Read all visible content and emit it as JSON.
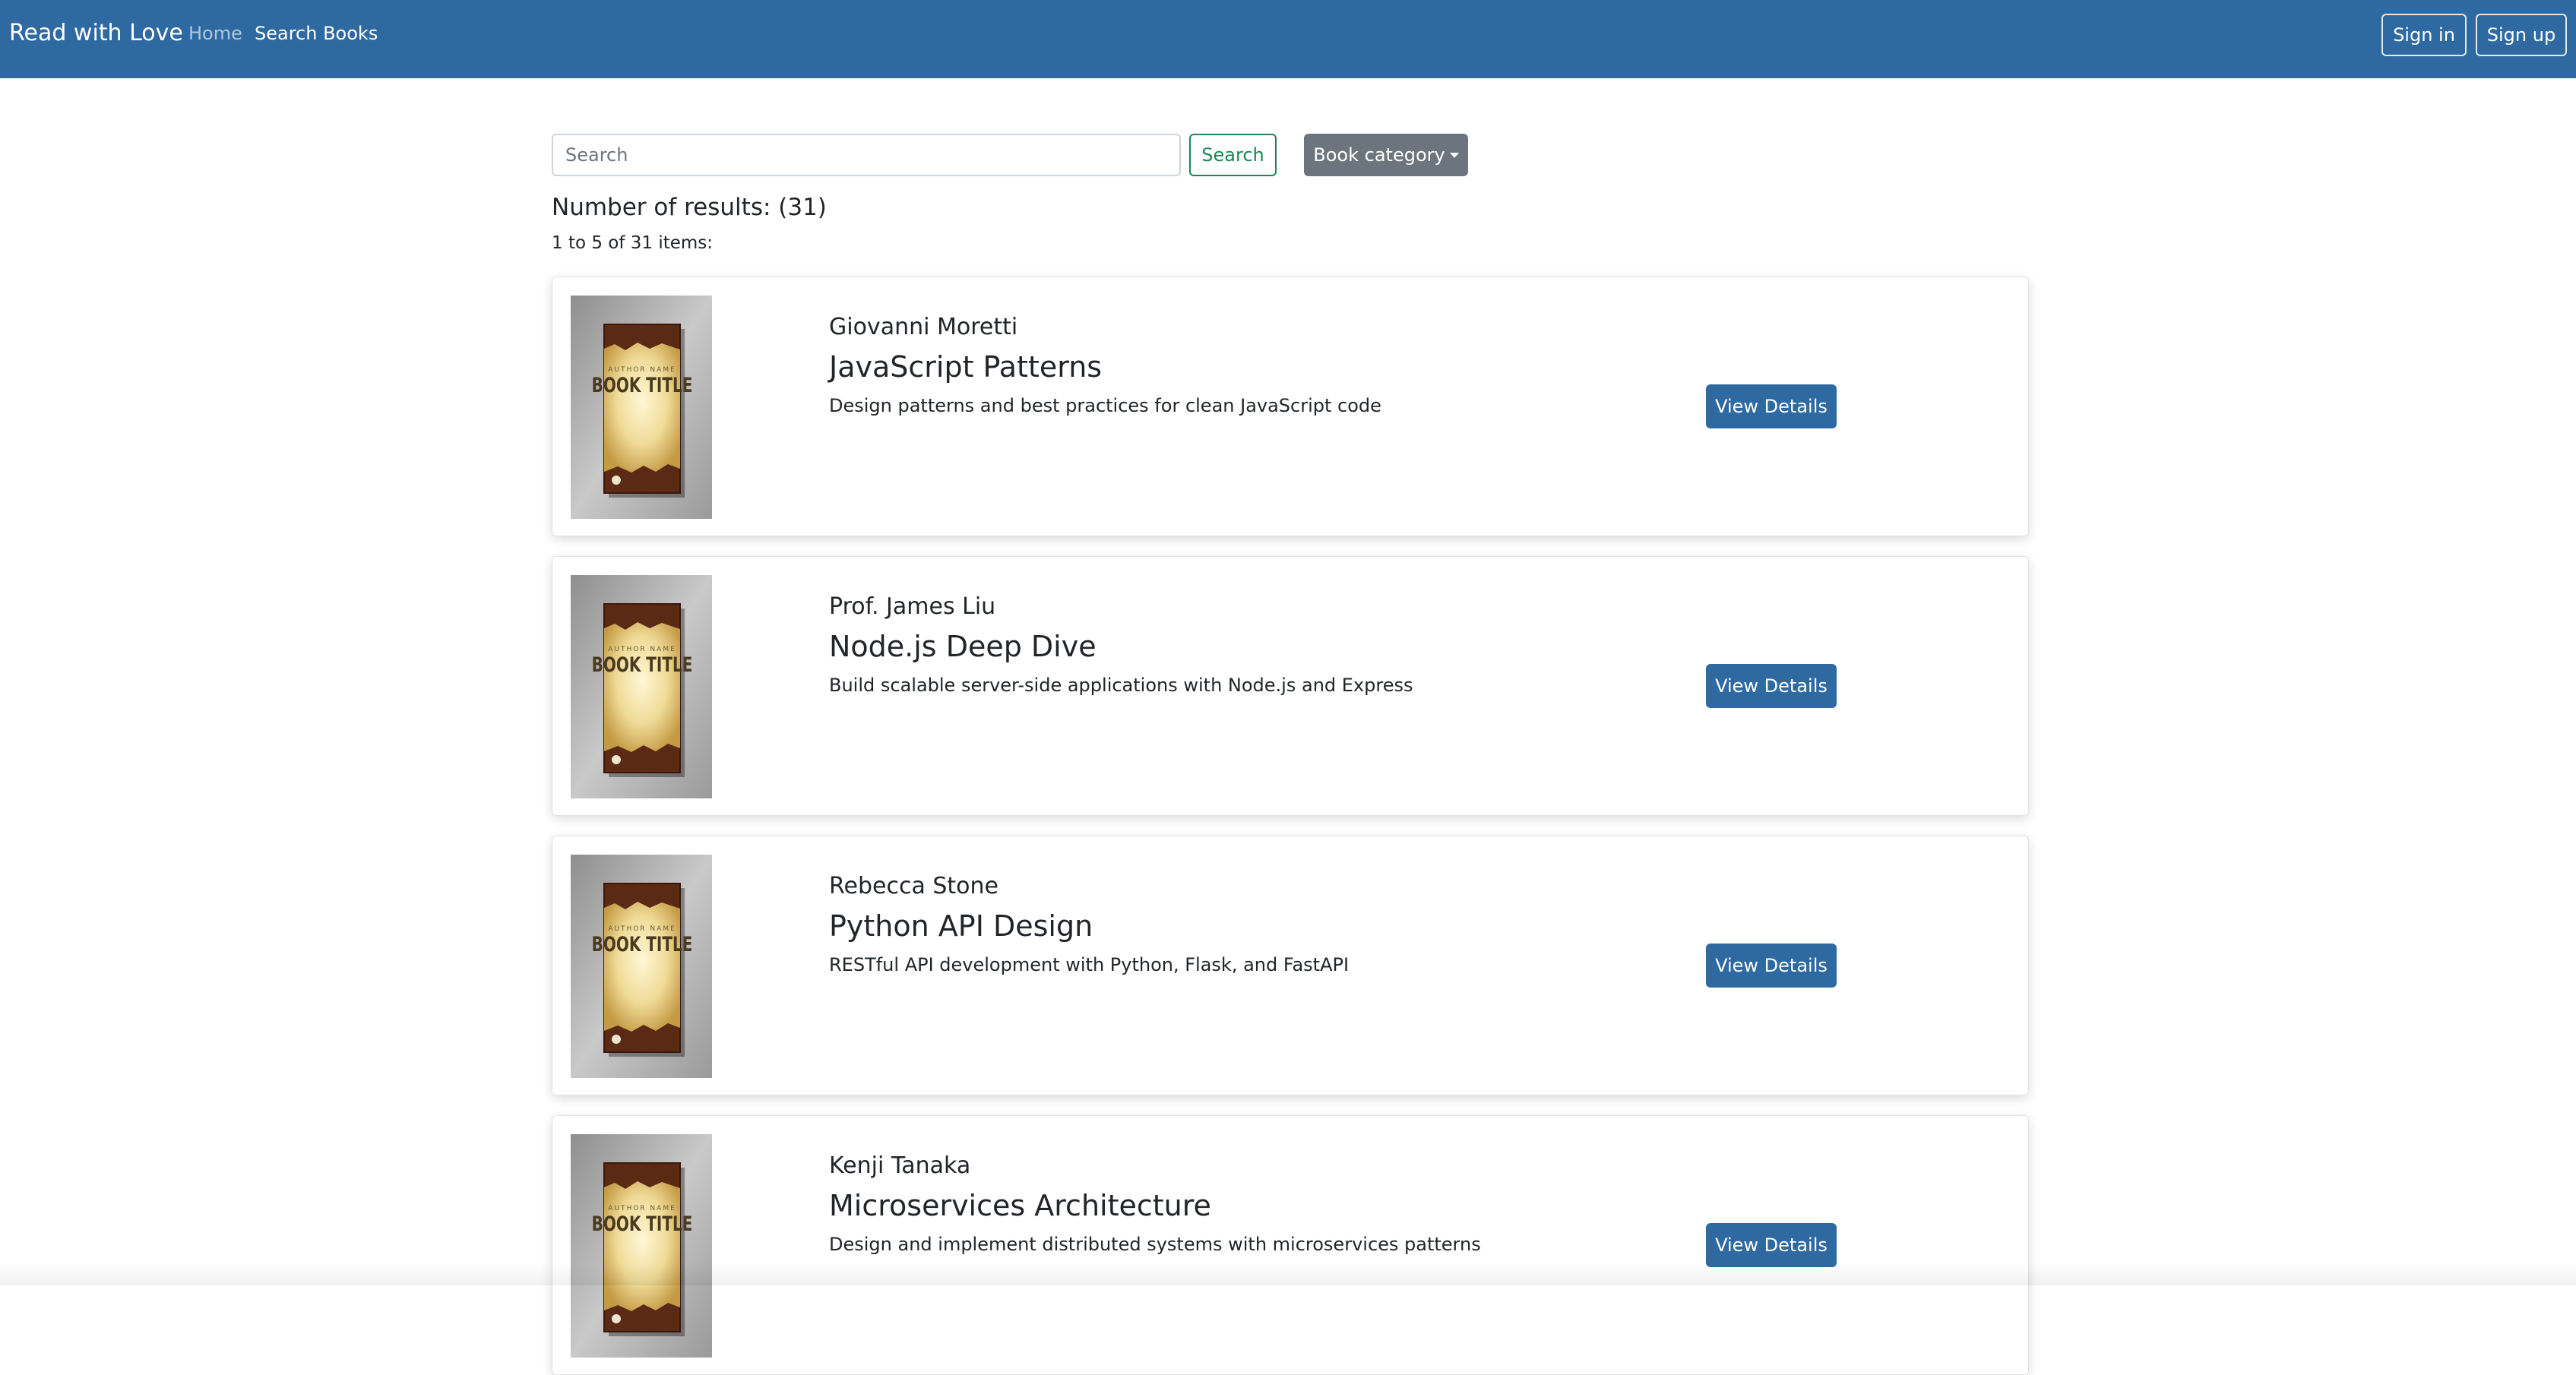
{
  "navbar": {
    "brand": "Read with Love",
    "home_label": "Home",
    "search_books_label": "Search Books",
    "signin_label": "Sign in",
    "signup_label": "Sign up",
    "background_color": "#2e6aa1"
  },
  "search": {
    "placeholder": "Search",
    "value": "",
    "button_label": "Search",
    "category_label": "Book category"
  },
  "results": {
    "count_text": "Number of results: (31)",
    "range_text": "1 to 5 of 31 items:"
  },
  "books": [
    {
      "author": "Giovanni Moretti",
      "title": "JavaScript Patterns",
      "description": "Design patterns and best practices for clean JavaScript code",
      "button_label": "View Details",
      "cover": {
        "author_text": "AUTHOR NAME",
        "title_text": "BOOK TITLE"
      }
    },
    {
      "author": "Prof. James Liu",
      "title": "Node.js Deep Dive",
      "description": "Build scalable server-side applications with Node.js and Express",
      "button_label": "View Details",
      "cover": {
        "author_text": "AUTHOR NAME",
        "title_text": "BOOK TITLE"
      }
    },
    {
      "author": "Rebecca Stone",
      "title": "Python API Design",
      "description": "RESTful API development with Python, Flask, and FastAPI",
      "button_label": "View Details",
      "cover": {
        "author_text": "AUTHOR NAME",
        "title_text": "BOOK TITLE"
      }
    },
    {
      "author": "Kenji Tanaka",
      "title": "Microservices Architecture",
      "description": "Design and implement distributed systems with microservices patterns",
      "button_label": "View Details",
      "cover": {
        "author_text": "AUTHOR NAME",
        "title_text": "BOOK TITLE"
      }
    }
  ],
  "colors": {
    "primary": "#2e6aa1",
    "success_outline": "#198754",
    "secondary": "#6c757d"
  }
}
